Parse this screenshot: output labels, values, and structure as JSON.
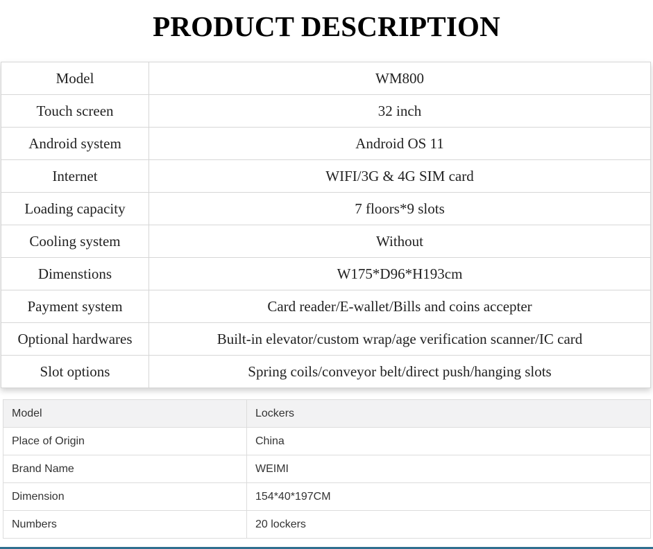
{
  "title": "PRODUCT DESCRIPTION",
  "spec_table": {
    "rows": [
      {
        "label": "Model",
        "value": "WM800"
      },
      {
        "label": "Touch screen",
        "value": "32 inch"
      },
      {
        "label": "Android system",
        "value": "Android OS 11"
      },
      {
        "label": "Internet",
        "value": "WIFI/3G & 4G SIM card"
      },
      {
        "label": "Loading capacity",
        "value": "7 floors*9 slots"
      },
      {
        "label": "Cooling system",
        "value": "Without"
      },
      {
        "label": "Dimenstions",
        "value": "W175*D96*H193cm"
      },
      {
        "label": "Payment system",
        "value": "Card reader/E-wallet/Bills and coins accepter"
      },
      {
        "label": "Optional hardwares",
        "value": "Built-in elevator/custom wrap/age verification scanner/IC card"
      },
      {
        "label": "Slot options",
        "value": "Spring coils/conveyor belt/direct push/hanging slots"
      }
    ]
  },
  "attr_table": {
    "rows": [
      {
        "label": "Model",
        "value": "Lockers"
      },
      {
        "label": "Place of Origin",
        "value": "China"
      },
      {
        "label": "Brand Name",
        "value": "WEIMI"
      },
      {
        "label": "Dimension",
        "value": "154*40*197CM"
      },
      {
        "label": "Numbers",
        "value": "20 lockers"
      }
    ]
  },
  "colors": {
    "header_row_bg": "#f2f2f3",
    "border": "#d6d6d6",
    "bottom_accent": "#2f6f8f"
  }
}
